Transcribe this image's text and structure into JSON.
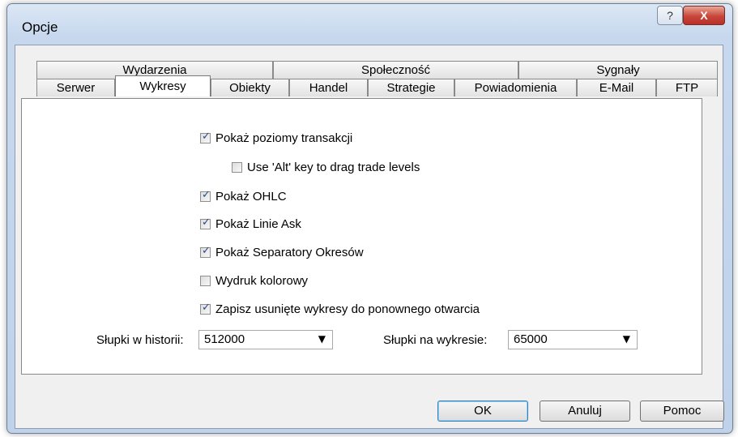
{
  "window": {
    "title": "Opcje",
    "help_glyph": "?",
    "close_glyph": "X"
  },
  "tabs": {
    "row1": [
      "Wydarzenia",
      "Społeczność",
      "Sygnały"
    ],
    "row2": [
      "Serwer",
      "Wykresy",
      "Obiekty",
      "Handel",
      "Strategie",
      "Powiadomienia",
      "E-Mail",
      "FTP"
    ],
    "selected": "Wykresy"
  },
  "options": [
    {
      "label": "Pokaż poziomy transakcji",
      "checked": true
    },
    {
      "label": "Use 'Alt' key to drag trade levels",
      "checked": false
    },
    {
      "label": "Pokaż OHLC",
      "checked": true
    },
    {
      "label": "Pokaż Linie Ask",
      "checked": true
    },
    {
      "label": "Pokaż Separatory Okresów",
      "checked": true
    },
    {
      "label": "Wydruk kolorowy",
      "checked": false
    },
    {
      "label": "Zapisz usunięte wykresy do ponownego otwarcia",
      "checked": true
    }
  ],
  "history": {
    "label": "Słupki w historii:",
    "value": "512000"
  },
  "chart": {
    "label": "Słupki na wykresie:",
    "value": "65000"
  },
  "buttons": {
    "ok": "OK",
    "cancel": "Anuluj",
    "help": "Pomoc"
  }
}
